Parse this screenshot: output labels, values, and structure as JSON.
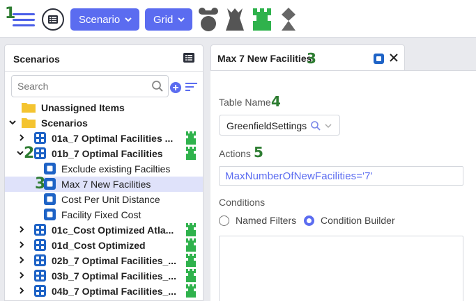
{
  "toolbar": {
    "markers": {
      "hamburger": "1"
    },
    "scenario_label": "Scenario",
    "grid_label": "Grid",
    "icons": [
      "hamburger-menu-icon",
      "list-icon",
      "bear-bin-icon",
      "triangle-piece-icon",
      "rook-icon",
      "diamond-piece-icon"
    ]
  },
  "left_panel": {
    "title": "Scenarios",
    "search": {
      "placeholder": "Search",
      "value": ""
    },
    "tree": [
      {
        "label": "Unassigned Items",
        "type": "folder",
        "bold": true
      },
      {
        "label": "Scenarios",
        "type": "folder",
        "bold": true,
        "expanded": true
      },
      {
        "label": "01a_7 Optimal Facilities ...",
        "type": "scenario",
        "bold": true,
        "badge": "rook"
      },
      {
        "label": "01b_7 Optimal Facilities",
        "type": "scenario",
        "bold": true,
        "expanded": true,
        "marker": "2",
        "badge": "rook"
      },
      {
        "label": "Exclude existing Facilties",
        "type": "item",
        "bold": false
      },
      {
        "label": "Max 7 New Facilities",
        "type": "item",
        "bold": false,
        "selected": true,
        "marker": "3"
      },
      {
        "label": "Cost Per Unit Distance",
        "type": "item",
        "bold": false
      },
      {
        "label": "Facility Fixed Cost",
        "type": "item",
        "bold": false
      },
      {
        "label": "01c_Cost Optimized Atla...",
        "type": "scenario",
        "bold": true,
        "badge": "rook"
      },
      {
        "label": "01d_Cost Optimized",
        "type": "scenario",
        "bold": true,
        "badge": "rook"
      },
      {
        "label": "02b_7 Optimal Facilities_...",
        "type": "scenario",
        "bold": true,
        "badge": "rook"
      },
      {
        "label": "03b_7 Optimal Facilities_...",
        "type": "scenario",
        "bold": true,
        "badge": "rook"
      },
      {
        "label": "04b_7 Optimal Facilities_...",
        "type": "scenario",
        "bold": true,
        "badge": "rook"
      }
    ]
  },
  "tab": {
    "title": "Max 7 New Facilities",
    "marker": "3"
  },
  "editor": {
    "table_name_label": "Table Name",
    "table_name_marker": "4",
    "table_name_value": "GreenfieldSettings",
    "actions_label": "Actions",
    "actions_marker": "5",
    "actions_value": "MaxNumberOfNewFacilities='7'",
    "conditions_label": "Conditions",
    "radio_named_filters": "Named Filters",
    "radio_condition_builder": "Condition Builder",
    "selected_radio": "Condition Builder"
  },
  "colors": {
    "accent": "#5b6cf0",
    "step_green": "#2e7d32",
    "badge_green": "#2fb24c",
    "tree_blue": "#1e63c6",
    "folder_yellow": "#f4c430",
    "selected_row": "#dfe2fa"
  }
}
